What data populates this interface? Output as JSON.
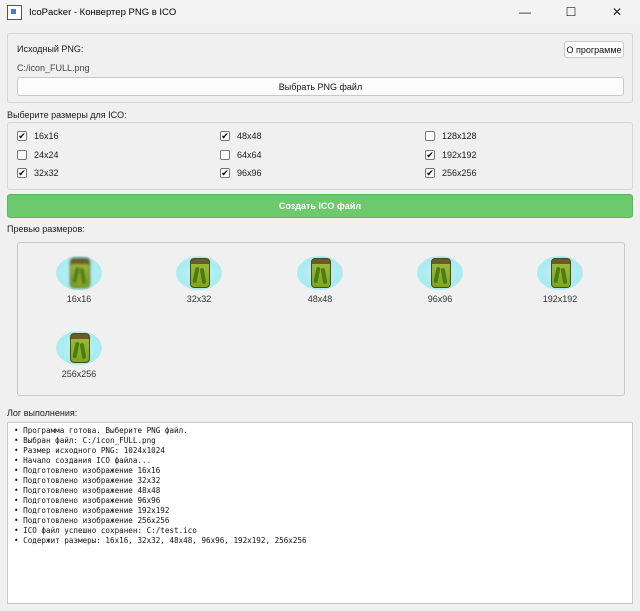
{
  "window": {
    "title": "IcoPacker - Конвертер PNG в ICO",
    "minimize": "—",
    "maximize": "☐",
    "close": "✕"
  },
  "source": {
    "label": "Исходный PNG:",
    "path": "C:/icon_FULL.png",
    "about_button": "О программе",
    "choose_button": "Выбрать PNG файл"
  },
  "sizes": {
    "label": "Выберите размеры для ICO:",
    "options": [
      {
        "label": "16x16",
        "checked": true
      },
      {
        "label": "48x48",
        "checked": true
      },
      {
        "label": "128x128",
        "checked": false
      },
      {
        "label": "24x24",
        "checked": false
      },
      {
        "label": "64x64",
        "checked": false
      },
      {
        "label": "192x192",
        "checked": true
      },
      {
        "label": "32x32",
        "checked": true
      },
      {
        "label": "96x96",
        "checked": true
      },
      {
        "label": "256x256",
        "checked": true
      }
    ]
  },
  "create_button": "Создать ICO файл",
  "preview": {
    "label": "Превью размеров:",
    "items": [
      "16x16",
      "32x32",
      "48x48",
      "96x96",
      "192x192",
      "256x256"
    ]
  },
  "log": {
    "label": "Лог выполнения:",
    "lines": [
      "• Программа готова. Выберите PNG файл.",
      "• Выбран файл: C:/icon_FULL.png",
      "• Размер исходного PNG: 1024x1024",
      "• Начало создания ICO файла...",
      "• Подготовлено изображение 16x16",
      "• Подготовлено изображение 32x32",
      "• Подготовлено изображение 48x48",
      "• Подготовлено изображение 96x96",
      "• Подготовлено изображение 192x192",
      "• Подготовлено изображение 256x256",
      "• ICO файл успешно сохранен: C:/test.ico",
      "• Содержит размеры: 16x16, 32x32, 48x48, 96x96, 192x192, 256x256"
    ]
  },
  "colors": {
    "create_button": "#6cc96c",
    "preview_glow": "#a9ecf0"
  }
}
